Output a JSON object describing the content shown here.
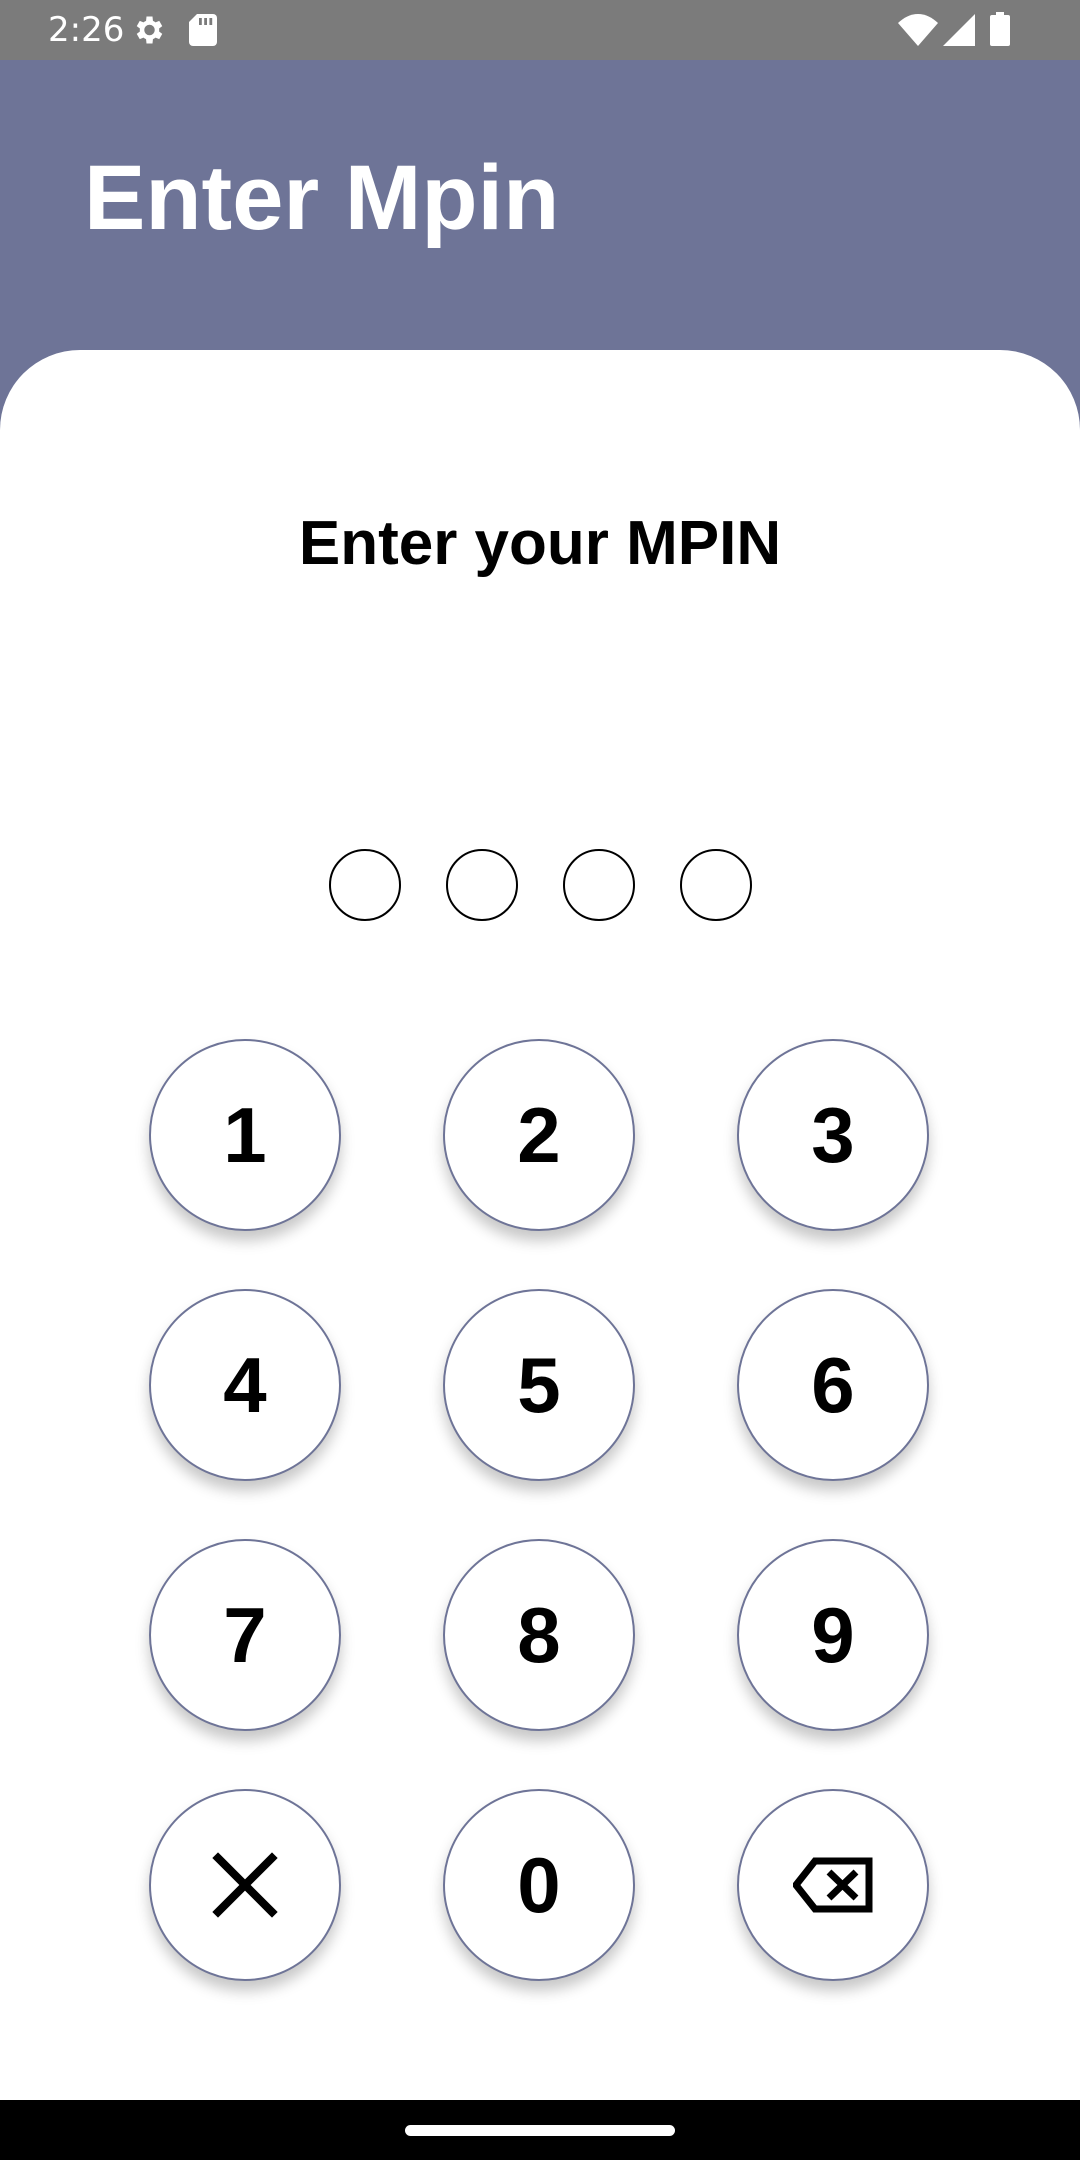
{
  "status_bar": {
    "time": "2:26",
    "icons": [
      "gear-icon",
      "sd-card-icon",
      "wifi-icon",
      "signal-icon",
      "battery-icon"
    ]
  },
  "header": {
    "title": "Enter Mpin",
    "background_color": "#6e7497"
  },
  "card": {
    "heading": "Enter your MPIN"
  },
  "pin": {
    "length": 4,
    "filled": 0
  },
  "keypad": {
    "keys": [
      "1",
      "2",
      "3",
      "4",
      "5",
      "6",
      "7",
      "8",
      "9",
      "",
      "0",
      ""
    ],
    "clear_icon": "close-icon",
    "backspace_icon": "backspace-icon",
    "accent_color": "#6e7497"
  },
  "nav_bar": {
    "icons": [
      "home-handle"
    ]
  }
}
